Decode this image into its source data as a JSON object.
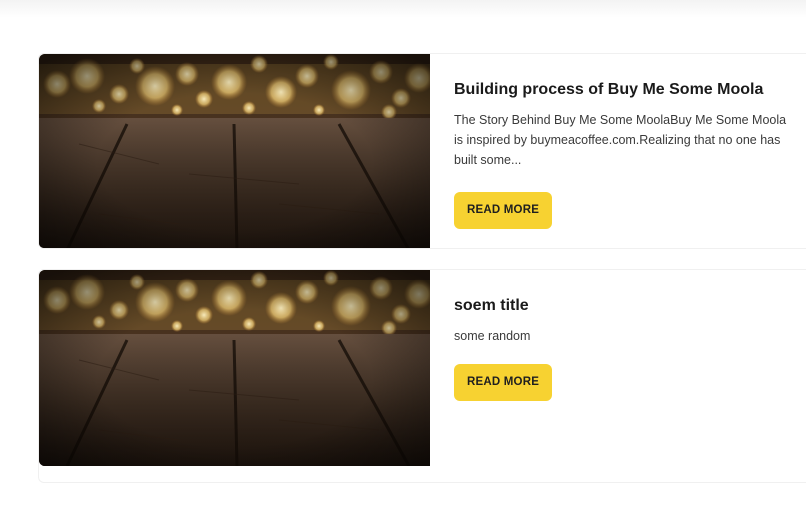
{
  "posts": [
    {
      "title": "Building process of Buy Me Some Moola",
      "excerpt": "The Story Behind Buy Me Some MoolaBuy Me Some Moola is inspired by buymeacoffee.com.Realizing that no one has built some...",
      "button_label": "READ MORE",
      "image_icon": "bokeh-wooden-table-image"
    },
    {
      "title": "soem title",
      "excerpt": "some random",
      "button_label": "READ MORE",
      "image_icon": "bokeh-wooden-table-image"
    }
  ],
  "colors": {
    "button_bg": "#f7d231",
    "card_border": "#f0f0f0",
    "title": "#1a1a1a"
  }
}
